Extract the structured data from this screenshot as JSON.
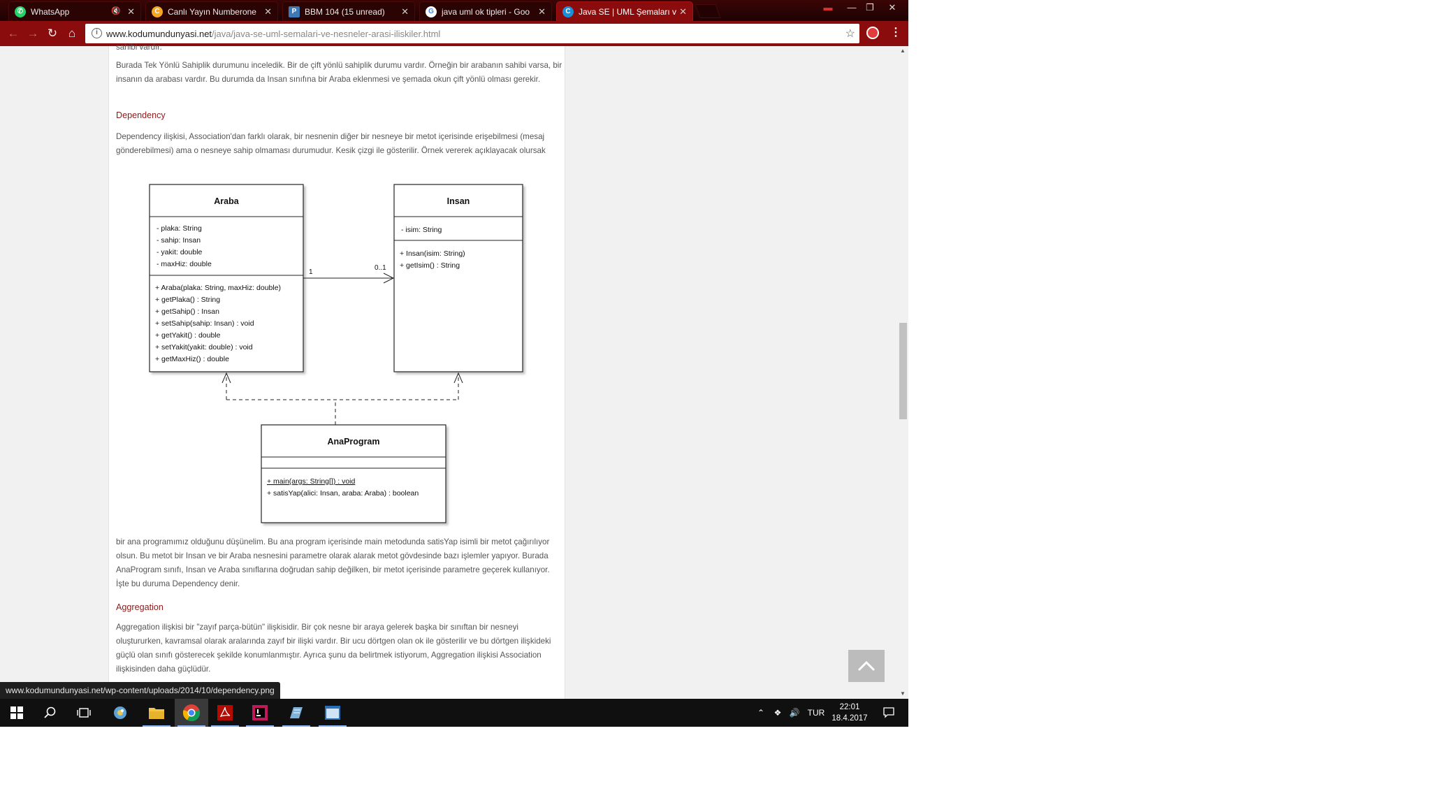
{
  "browser": {
    "tabs": [
      {
        "title": "WhatsApp",
        "icon": "whatsapp-icon",
        "color": "#25d366",
        "active": false
      },
      {
        "title": "Canlı Yayın Numberone",
        "icon": "radio-icon",
        "color": "#f5a623",
        "active": false
      },
      {
        "title": "BBM 104 (15 unread)",
        "icon": "piazza-icon",
        "color": "#3d7ab5",
        "active": false
      },
      {
        "title": "java uml ok tipleri - Goo",
        "icon": "google-icon",
        "color": "#ffffff",
        "active": false
      },
      {
        "title": "Java SE | UML Şemaları v",
        "icon": "site-icon",
        "color": "#1c8fd6",
        "active": true
      }
    ],
    "url_host": "www.kodumundunyasi.net",
    "url_path": "/java/java-se-uml-semalari-ve-nesneler-arasi-iliskiler.html"
  },
  "article": {
    "cutoff_line": "sahibi vardır.",
    "paragraph1": "Burada Tek Yönlü Sahiplik durumunu inceledik. Bir de çift yönlü sahiplik durumu vardır. Örneğin bir arabanın sahibi varsa, bir insanın da arabası vardır. Bu durumda da Insan sınıfına bir Araba eklenmesi ve şemada okun çift yönlü olması gerekir.",
    "heading_dependency": "Dependency",
    "paragraph2": "Dependency ilişkisi, Association'dan farklı olarak, bir nesnenin diğer bir nesneye bir metot içerisinde erişebilmesi (mesaj gönderebilmesi) ama o nesneye sahip olmaması durumudur. Kesik çizgi ile gösterilir. Örnek vererek açıklayacak olursak",
    "paragraph3": "bir ana programımız olduğunu düşünelim. Bu ana program içerisinde main metodunda satisYap isimli bir metot çağırılıyor olsun. Bu metot bir Insan ve bir Araba nesnesini parametre olarak alarak metot gövdesinde bazı işlemler yapıyor. Burada AnaProgram sınıfı, Insan ve Araba sınıflarına doğrudan sahip değilken, bir metot içerisinde parametre geçerek kullanıyor. İşte bu duruma Dependency denir.",
    "heading_aggregation": "Aggregation",
    "paragraph4": "Aggregation ilişkisi bir \"zayıf parça-bütün\" ilişkisidir. Bir çok nesne bir araya gelerek başka bir sınıftan bir nesneyi oluştururken, kavramsal olarak aralarında zayıf bir ilişki vardır. Bir ucu dörtgen olan ok ile gösterilir ve bu dörtgen ilişkideki güçlü olan sınıfı gösterecek şekilde konumlanmıştır. Ayrıca şunu da belirtmek istiyorum, Aggregation ilişkisi Association ilişkisinden daha güçlüdür."
  },
  "uml": {
    "araba": {
      "name": "Araba",
      "attributes": [
        "- plaka: String",
        "- sahip: Insan",
        "- yakit: double",
        "- maxHiz: double"
      ],
      "methods": [
        "+ Araba(plaka: String, maxHiz: double)",
        "+ getPlaka() : String",
        "+ getSahip() : Insan",
        "+ setSahip(sahip: Insan) : void",
        "+ getYakit() : double",
        "+ setYakit(yakit: double) : void",
        "+ getMaxHiz() : double"
      ]
    },
    "insan": {
      "name": "Insan",
      "attributes": [
        "- isim: String"
      ],
      "methods": [
        "+ Insan(isim: String)",
        "+ getIsim() : String"
      ]
    },
    "anaprogram": {
      "name": "AnaProgram",
      "methods": [
        "+ main(args: String[]) : void",
        "+ satisYap(alici: Insan, araba: Araba) : boolean"
      ]
    },
    "multiplicity_left": "1",
    "multiplicity_right": "0..1"
  },
  "status_bar_url": "www.kodumundunyasi.net/wp-content/uploads/2014/10/dependency.png",
  "taskbar": {
    "language": "TUR",
    "time": "22:01",
    "date": "18.4.2017"
  }
}
